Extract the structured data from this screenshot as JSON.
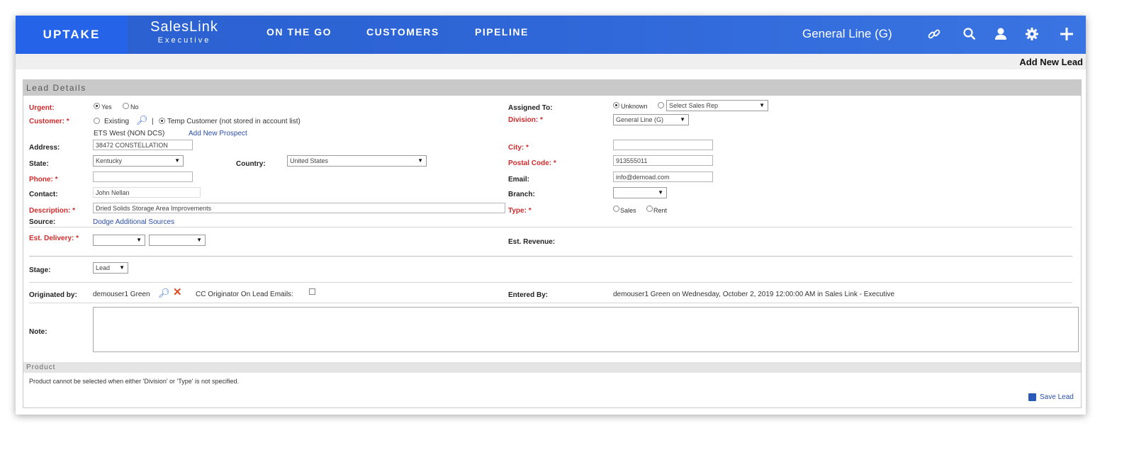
{
  "topbar": {
    "logo": "UPTAKE",
    "brand_line1": "SalesLink",
    "brand_line2": "Executive",
    "nav": [
      "ON THE GO",
      "CUSTOMERS",
      "PIPELINE"
    ],
    "division": "General Line (G)",
    "icons": [
      "link-icon",
      "search-icon",
      "user-icon",
      "gear-icon",
      "plus-icon"
    ]
  },
  "page_action": "Add New Lead",
  "lead_details": {
    "section_title": "Lead Details",
    "urgent_label": "Urgent:",
    "urgent_yes": "Yes",
    "urgent_no": "No",
    "customer_label": "Customer: *",
    "customer_existing": "Existing",
    "customer_divider": "|",
    "customer_temp": "Temp Customer (not stored in account list)",
    "customer_name": "ETS West (NON DCS)",
    "add_prospect": "Add New Prospect",
    "address_label": "Address:",
    "address_value": "38472 CONSTELLATION",
    "state_label": "State:",
    "state_value": "Kentucky",
    "country_label": "Country:",
    "country_value": "United States",
    "phone_label": "Phone: *",
    "phone_value": "",
    "contact_label": "Contact:",
    "contact_value": "John Nellan",
    "description_label": "Description: *",
    "description_value": "Dried Solids Storage Area Improvements",
    "source_label": "Source:",
    "source_value": "Dodge Additional Sources",
    "est_delivery_label": "Est. Delivery: *",
    "stage_label": "Stage:",
    "stage_value": "Lead",
    "originated_label": "Originated by:",
    "originated_value": "demouser1 Green",
    "cc_label": "CC Originator On Lead Emails:",
    "assigned_label": "Assigned To:",
    "assigned_unknown": "Unknown",
    "assigned_select": "Select Sales Rep",
    "division_label": "Division: *",
    "division_value": "General Line (G)",
    "city_label": "City: *",
    "city_value": "",
    "postal_label": "Postal Code: *",
    "postal_value": "913555011",
    "email_label": "Email:",
    "email_value": "info@demoad.com",
    "branch_label": "Branch:",
    "branch_value": "",
    "type_label": "Type: *",
    "type_sales": "Sales",
    "type_rent": "Rent",
    "est_revenue_label": "Est. Revenue:",
    "entered_label": "Entered By:",
    "entered_value": "demouser1 Green on Wednesday, October 2, 2019 12:00:00 AM in Sales Link - Executive",
    "note_label": "Note:",
    "note_value": ""
  },
  "product": {
    "section_title": "Product",
    "message": "Product cannot be selected when either 'Division' or 'Type' is not specified.",
    "save_label": "Save Lead"
  }
}
